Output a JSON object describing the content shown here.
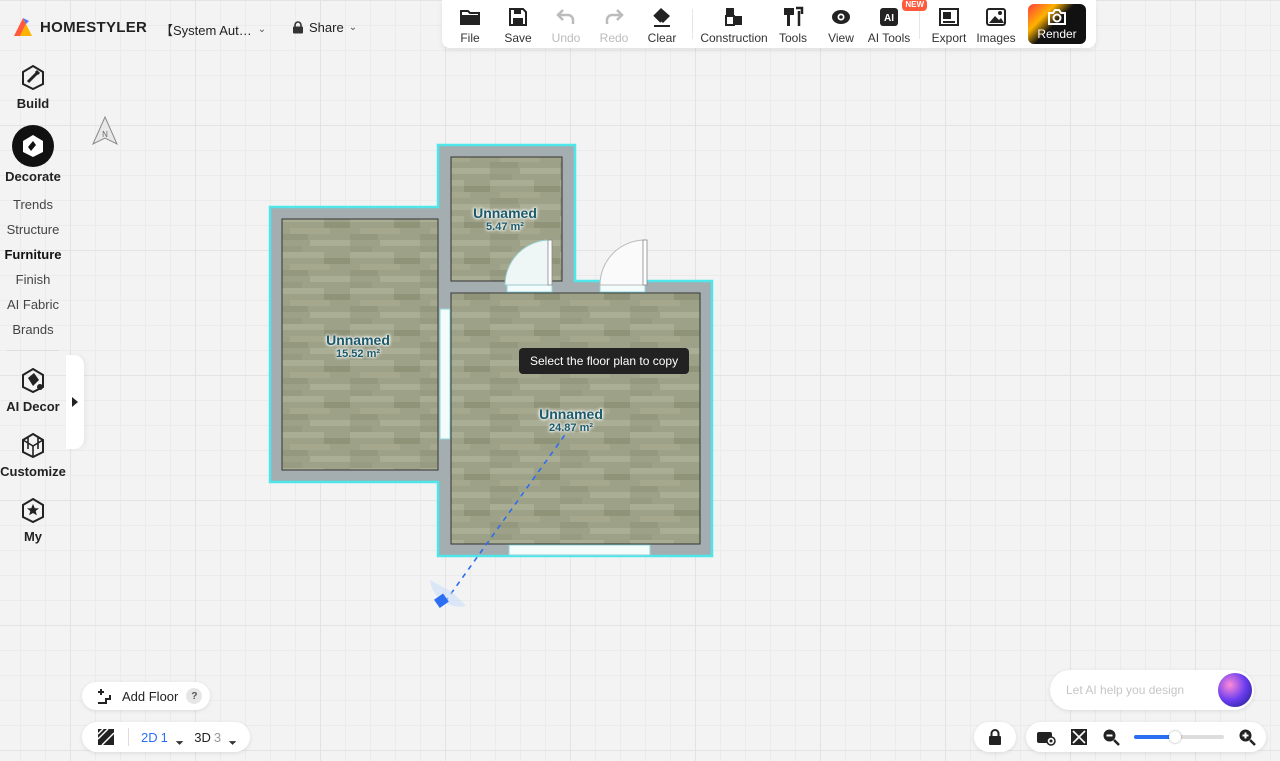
{
  "app": {
    "brand": "HOMESTYLER",
    "project_title": "【System Aut…",
    "share_label": "Share"
  },
  "toolbar": {
    "file": "File",
    "save": "Save",
    "undo": "Undo",
    "redo": "Redo",
    "clear": "Clear",
    "construction": "Construction",
    "tools": "Tools",
    "view": "View",
    "ai_tools": "AI Tools",
    "new_badge": "NEW",
    "export": "Export",
    "images": "Images",
    "render": "Render"
  },
  "sidebar": {
    "build": "Build",
    "decorate": "Decorate",
    "sub_items": [
      "Trends",
      "Structure",
      "Furniture",
      "Finish",
      "AI Fabric",
      "Brands"
    ],
    "active_sub": "Furniture",
    "ai_decor": "AI Decor",
    "customize": "Customize",
    "my": "My"
  },
  "compass": {
    "label": "N"
  },
  "rooms": [
    {
      "name": "Unnamed",
      "area": "5.47 m²"
    },
    {
      "name": "Unnamed",
      "area": "15.52 m²"
    },
    {
      "name": "Unnamed",
      "area": "24.87 m²"
    }
  ],
  "tooltip": "Select the floor plan to copy",
  "bottom": {
    "add_floor": "Add Floor",
    "help": "?",
    "view_2d": "2D",
    "view_2d_count": "1",
    "view_3d": "3D",
    "view_3d_count": "3",
    "ai_placeholder": "Let AI help you design",
    "zoom_level": 0.45
  },
  "colors": {
    "accent": "#2b6ef2",
    "wall": "#a4adaf",
    "selection": "#4ee6ea",
    "room_label": "#1c5a6b"
  }
}
